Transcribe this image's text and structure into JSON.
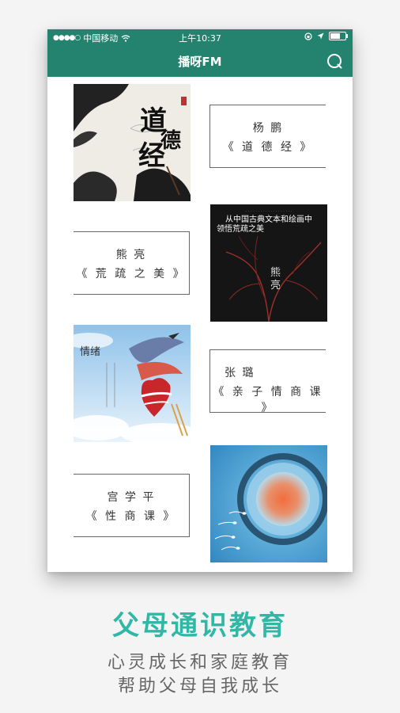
{
  "status_bar": {
    "carrier": "中国移动",
    "time": "上午10:37"
  },
  "header": {
    "title": "播呀FM"
  },
  "courses": [
    {
      "teacher": "杨 鹏",
      "title": "《 道 德 经 》",
      "cover_text": "道德经"
    },
    {
      "teacher": "熊 亮",
      "title": "《 荒 疏 之 美 》",
      "cover_text": "从中国古典文本和绘画中领悟荒疏之美"
    },
    {
      "teacher": "张 璐",
      "title": "《 亲 子 情 商 课 》",
      "cover_text": "情绪"
    },
    {
      "teacher": "宫 学 平",
      "title": "《 性 商 课 》"
    }
  ],
  "promo": {
    "headline": "父母通识教育",
    "line1": "心灵成长和家庭教育",
    "line2": "帮助父母自我成长"
  },
  "colors": {
    "brand": "#23836f",
    "headline": "#2fb8a6"
  }
}
